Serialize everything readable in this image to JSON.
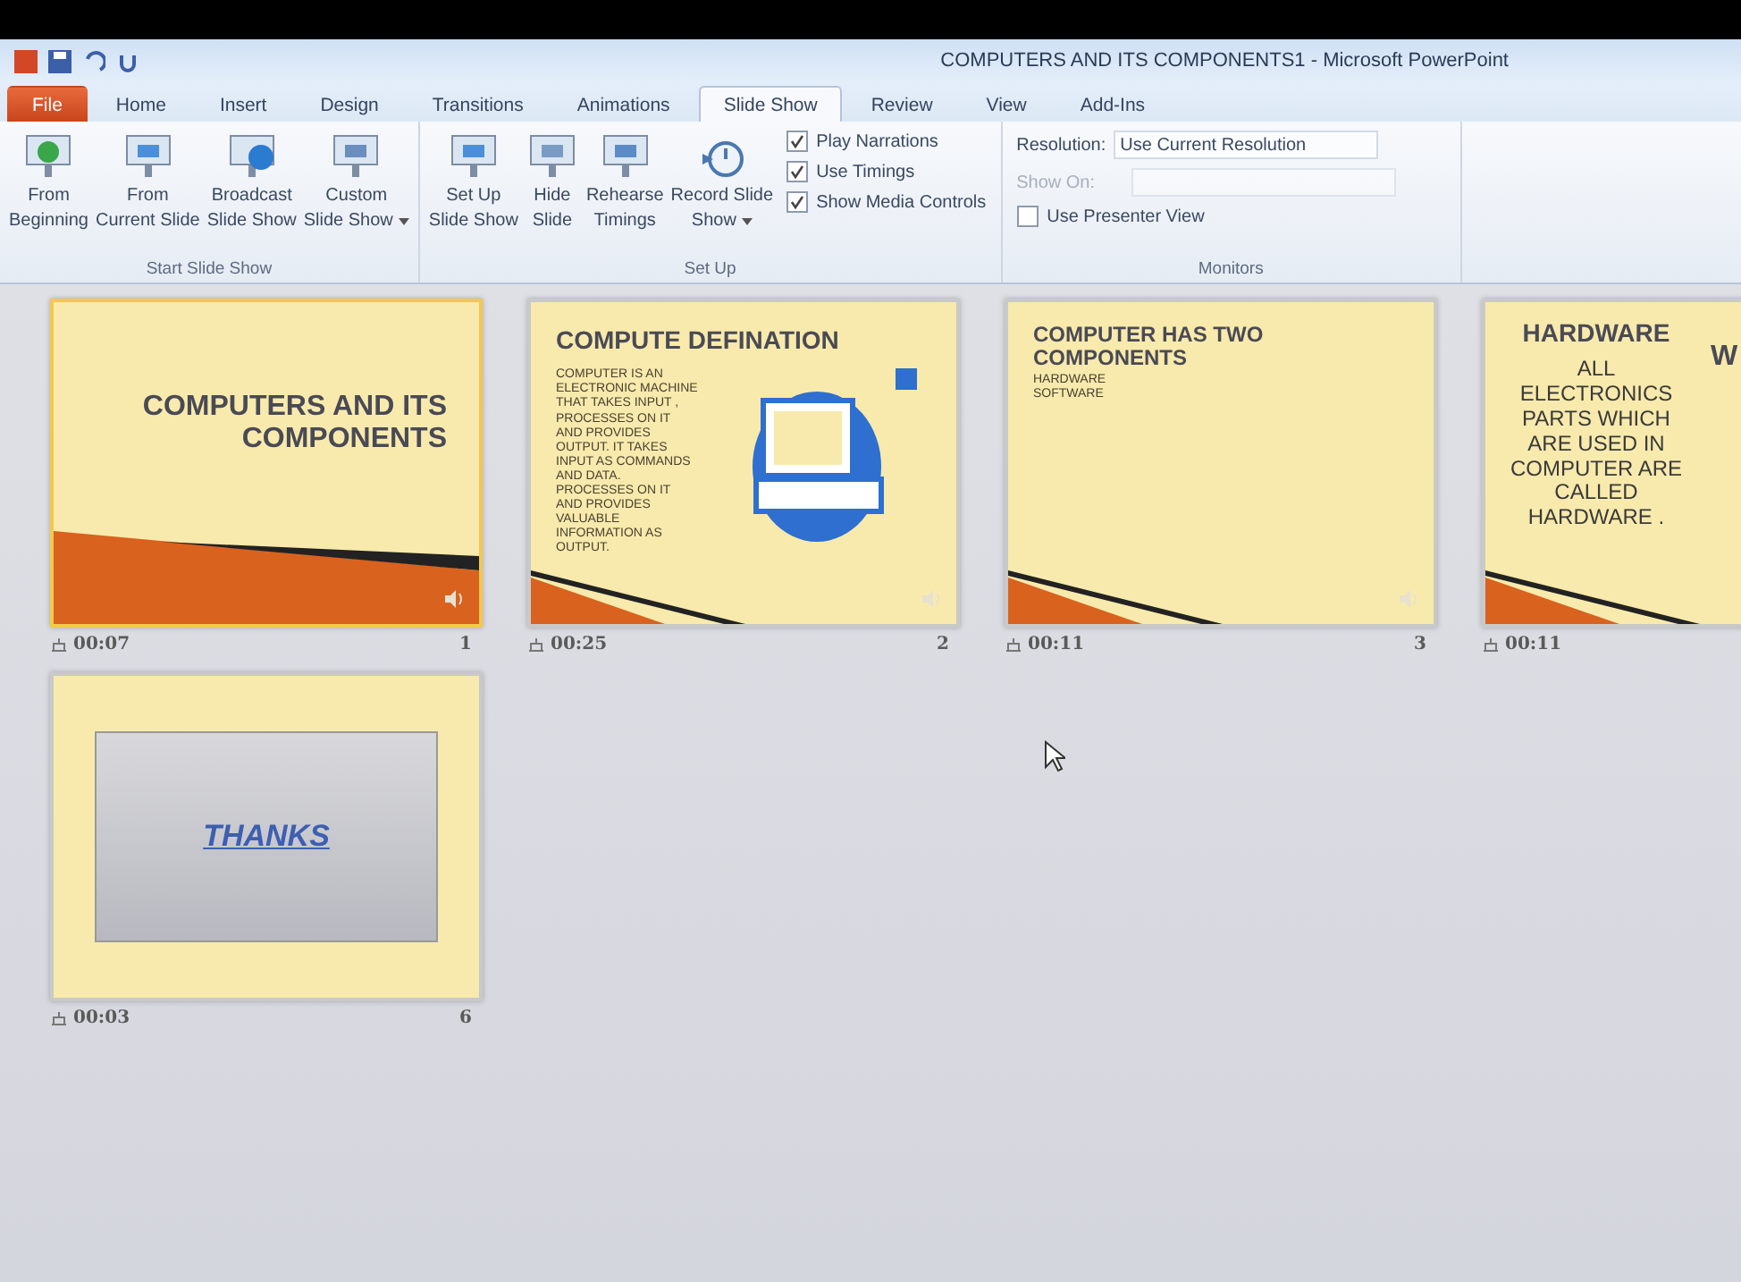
{
  "window": {
    "title": "COMPUTERS AND ITS COMPONENTS1  -  Microsoft PowerPoint"
  },
  "tabs": [
    {
      "label": "File",
      "kind": "file",
      "selected": false
    },
    {
      "label": "Home",
      "kind": "tab",
      "selected": false
    },
    {
      "label": "Insert",
      "kind": "tab",
      "selected": false
    },
    {
      "label": "Design",
      "kind": "tab",
      "selected": false
    },
    {
      "label": "Transitions",
      "kind": "tab",
      "selected": false
    },
    {
      "label": "Animations",
      "kind": "tab",
      "selected": false
    },
    {
      "label": "Slide Show",
      "kind": "tab",
      "selected": true
    },
    {
      "label": "Review",
      "kind": "tab",
      "selected": false
    },
    {
      "label": "View",
      "kind": "tab",
      "selected": false
    },
    {
      "label": "Add-Ins",
      "kind": "tab",
      "selected": false
    }
  ],
  "groups": [
    {
      "label": "Start Slide Show",
      "items": [
        {
          "kind": "button",
          "lines": [
            "From",
            "Beginning"
          ],
          "dropdown": false
        },
        {
          "kind": "button",
          "lines": [
            "From",
            "Current Slide"
          ],
          "dropdown": false
        },
        {
          "kind": "button",
          "lines": [
            "Broadcast",
            "Slide Show"
          ],
          "dropdown": false
        },
        {
          "kind": "button",
          "lines": [
            "Custom",
            "Slide Show"
          ],
          "dropdown": true
        }
      ]
    },
    {
      "label": "Set Up",
      "items": [
        {
          "kind": "button",
          "lines": [
            "Set Up",
            "Slide Show"
          ],
          "dropdown": false
        },
        {
          "kind": "button",
          "lines": [
            "Hide",
            "Slide"
          ],
          "dropdown": false
        },
        {
          "kind": "button",
          "lines": [
            "Rehearse",
            "Timings"
          ],
          "dropdown": false
        },
        {
          "kind": "button",
          "lines": [
            "Record Slide",
            "Show"
          ],
          "dropdown": true
        },
        {
          "kind": "checks",
          "checks": [
            {
              "label": "Play Narrations",
              "checked": true
            },
            {
              "label": "Use Timings",
              "checked": true
            },
            {
              "label": "Show Media Controls",
              "checked": true
            }
          ]
        }
      ]
    },
    {
      "label": "Monitors",
      "items": [
        {
          "kind": "monitors",
          "resolution_label": "Resolution:",
          "resolution_value": "Use Current Resolution",
          "show_on_label": "Show On:",
          "show_on_disabled": true,
          "presenter": {
            "label": "Use Presenter View",
            "checked": false
          }
        }
      ]
    }
  ],
  "slides": [
    {
      "number": "1",
      "time": "00:07",
      "kind": "title",
      "selected": true,
      "title": "COMPUTERS AND ITS COMPONENTS"
    },
    {
      "number": "2",
      "time": "00:25",
      "kind": "text-image",
      "selected": false,
      "title": "COMPUTE DEFINATION",
      "body": [
        "COMPUTER IS AN ELECTRONIC MACHINE THAT TAKES INPUT , PROCESSES ON IT AND PROVIDES OUTPUT. IT TAKES INPUT AS COMMANDS AND DATA. PROCESSES ON IT AND PROVIDES VALUABLE INFORMATION AS OUTPUT."
      ]
    },
    {
      "number": "3",
      "time": "00:11",
      "kind": "bullets",
      "selected": false,
      "title": "COMPUTER HAS TWO COMPONENTS",
      "body": [
        "HARDWARE",
        "SOFTWARE"
      ]
    },
    {
      "time": "00:11",
      "kind": "centered",
      "selected": false,
      "title": "HARDWARE",
      "body": [
        "ALL ELECTRONICS PARTS WHICH ARE USED IN COMPUTER ARE CALLED HARDWARE ."
      ],
      "side_title": "W"
    },
    {
      "number": "6",
      "time": "00:03",
      "kind": "thanks",
      "selected": false,
      "title": "THANKS"
    }
  ]
}
